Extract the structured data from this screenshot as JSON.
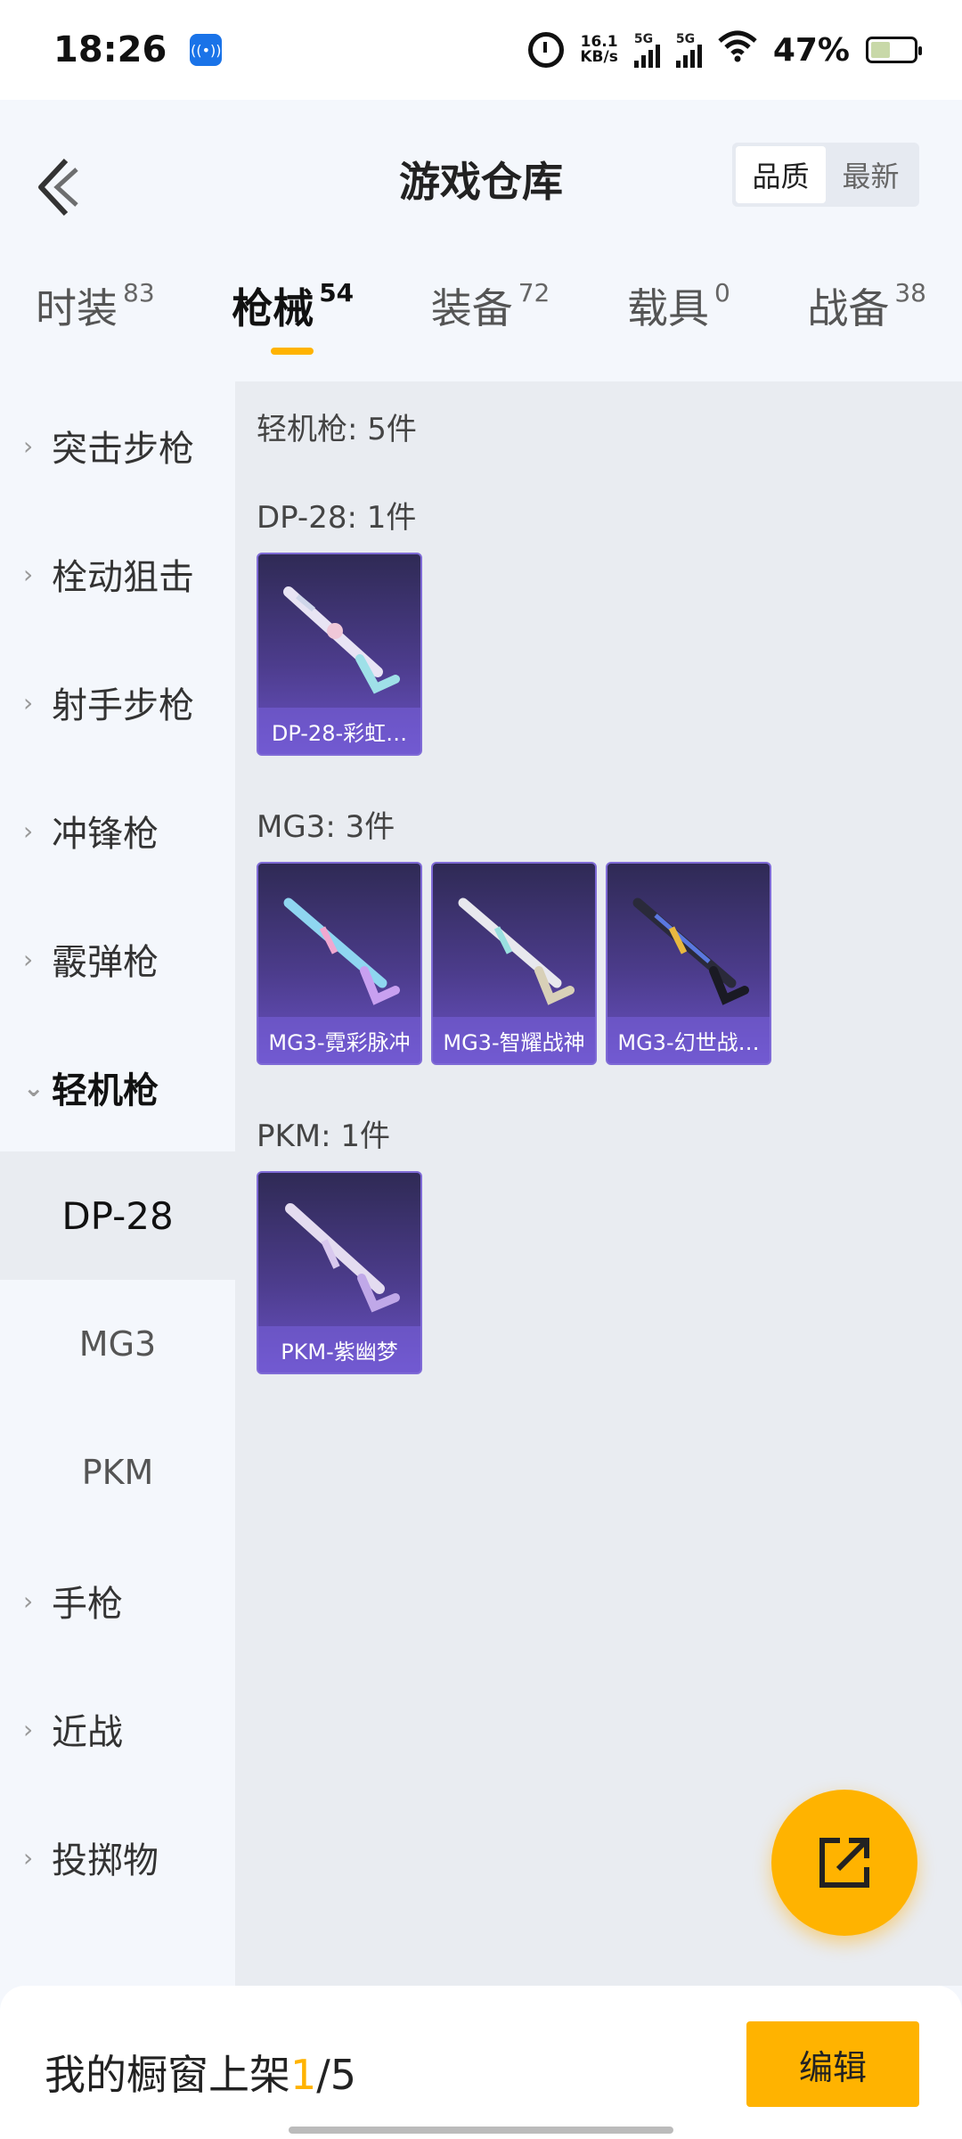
{
  "status_bar": {
    "time": "18:26",
    "net_speed_value": "16.1",
    "net_speed_unit": "KB/s",
    "signal1_tag": "5G",
    "signal2_tag": "5G",
    "battery_percent": "47%",
    "icons": [
      "hotspot-icon",
      "alarm-icon",
      "wifi-icon",
      "battery-icon"
    ]
  },
  "header": {
    "title": "游戏仓库",
    "sort_options": [
      "品质",
      "最新"
    ],
    "sort_selected": "品质"
  },
  "tabs": [
    {
      "label": "时装",
      "count": "83"
    },
    {
      "label": "枪械",
      "count": "54"
    },
    {
      "label": "装备",
      "count": "72"
    },
    {
      "label": "载具",
      "count": "0"
    },
    {
      "label": "战备",
      "count": "38"
    }
  ],
  "active_tab": "枪械",
  "sidebar": {
    "categories_top": [
      "突击步枪",
      "栓动狙击",
      "射手步枪",
      "冲锋枪",
      "霰弹枪"
    ],
    "open_category": "轻机枪",
    "subcategories": [
      "DP-28",
      "MG3",
      "PKM"
    ],
    "active_subcategory": "DP-28",
    "categories_bottom": [
      "手枪",
      "近战",
      "投掷物"
    ]
  },
  "content": {
    "total": "轻机枪: 5件",
    "groups": [
      {
        "title": "DP-28: 1件",
        "items": [
          "DP-28-彩虹…"
        ]
      },
      {
        "title": "MG3: 3件",
        "items": [
          "MG3-霓彩脉冲",
          "MG3-智耀战神",
          "MG3-幻世战…"
        ]
      },
      {
        "title": "PKM: 1件",
        "items": [
          "PKM-紫幽梦"
        ]
      }
    ]
  },
  "bottom": {
    "showcase_label": "我的橱窗上架",
    "showcase_current": "1",
    "showcase_total": "/5",
    "edit_label": "编辑"
  },
  "colors": {
    "accent": "#ffb300",
    "card_top": "#2f2a55",
    "card_bottom": "#6a52c4"
  }
}
